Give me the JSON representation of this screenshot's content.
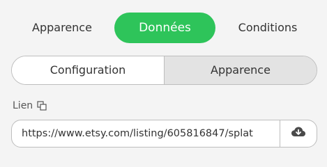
{
  "top_tabs": {
    "apparence": "Apparence",
    "donnees": "Données",
    "conditions": "Conditions",
    "active": "Données"
  },
  "segmented": {
    "configuration": "Configuration",
    "apparence": "Apparence",
    "selected": "Apparence"
  },
  "link": {
    "label": "Lien",
    "value": "https://www.etsy.com/listing/605816847/splat"
  },
  "icons": {
    "copy": "copy-icon",
    "upload": "cloud-download-icon"
  },
  "colors": {
    "accent": "#2ec45a",
    "selected_segment": "#e3e3e3",
    "background": "#f4f4f4"
  }
}
